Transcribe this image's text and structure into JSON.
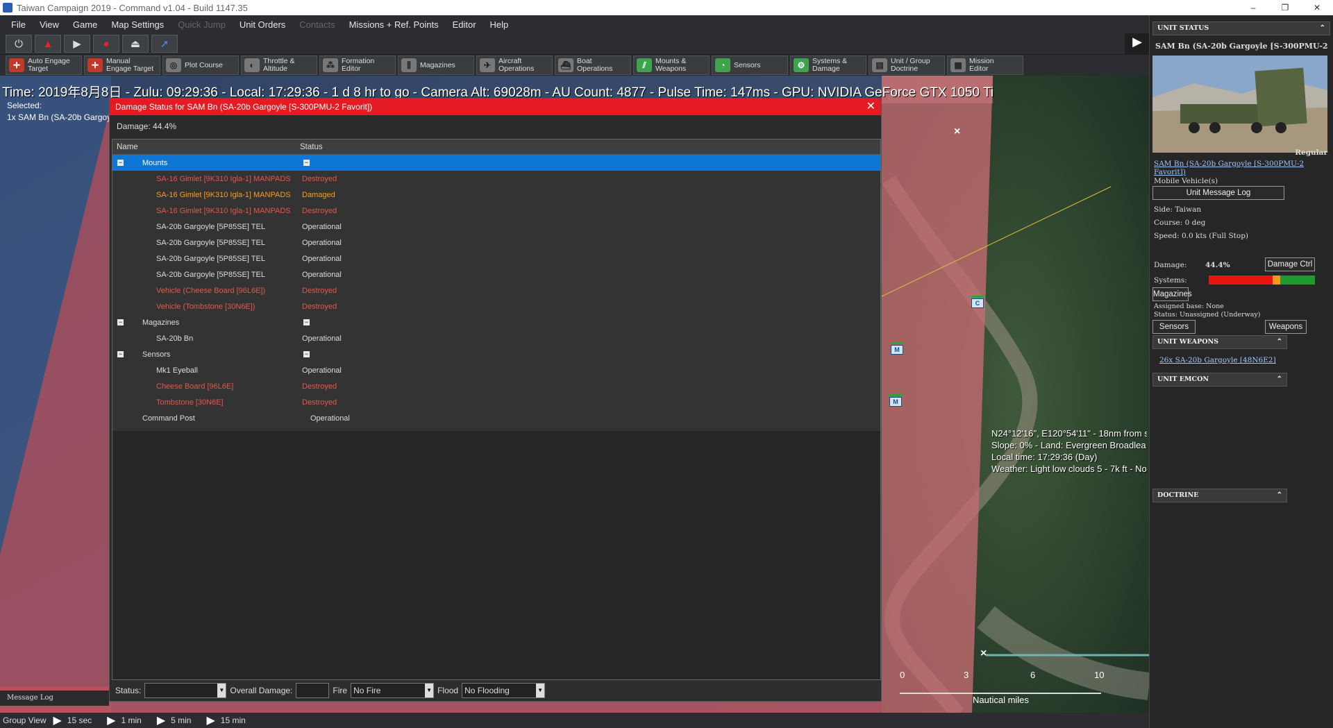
{
  "window": {
    "title": "Taiwan  Campaign 2019 - Command v1.04 - Build 1147.35",
    "buttons": [
      "–",
      "❐",
      "✕"
    ]
  },
  "menubar": {
    "items": [
      {
        "label": "File",
        "enabled": true
      },
      {
        "label": "View",
        "enabled": true
      },
      {
        "label": "Game",
        "enabled": true
      },
      {
        "label": "Map Settings",
        "enabled": true
      },
      {
        "label": "Quick Jump",
        "enabled": false
      },
      {
        "label": "Unit Orders",
        "enabled": true
      },
      {
        "label": "Contacts",
        "enabled": false
      },
      {
        "label": "Missions + Ref. Points",
        "enabled": true
      },
      {
        "label": "Editor",
        "enabled": true
      },
      {
        "label": "Help",
        "enabled": true
      }
    ]
  },
  "toolbar": {
    "row1": [
      {
        "icon": "power-icon",
        "glyph": "⏻"
      },
      {
        "icon": "fire-icon",
        "glyph": "🔥"
      },
      {
        "icon": "play-icon",
        "glyph": "▶"
      },
      {
        "icon": "record-icon",
        "glyph": "●"
      },
      {
        "icon": "eject-icon",
        "glyph": "⏏"
      },
      {
        "icon": "cursor-icon",
        "glyph": "➚"
      }
    ],
    "row2": [
      {
        "line1": "Auto Engage",
        "line2": "Target",
        "icon": "crosshair-icon",
        "style": "red"
      },
      {
        "line1": "Manual",
        "line2": "Engage Target",
        "icon": "crosshair-icon",
        "style": "red"
      },
      {
        "line1": "Plot Course",
        "line2": "",
        "icon": "compass-icon",
        "style": ""
      },
      {
        "line1": "Throttle &",
        "line2": "Altitude",
        "icon": "gauge-icon",
        "style": ""
      },
      {
        "line1": "Formation",
        "line2": "Editor",
        "icon": "formation-icon",
        "style": ""
      },
      {
        "line1": "Magazines",
        "line2": "",
        "icon": "ammo-icon",
        "style": ""
      },
      {
        "line1": "Aircraft",
        "line2": "Operations",
        "icon": "aircraft-icon",
        "style": ""
      },
      {
        "line1": "Boat",
        "line2": "Operations",
        "icon": "boat-icon",
        "style": ""
      },
      {
        "line1": "Mounts &",
        "line2": "Weapons",
        "icon": "weapons-icon",
        "style": "grn"
      },
      {
        "line1": "Sensors",
        "line2": "",
        "icon": "radar-icon",
        "style": "grn"
      },
      {
        "line1": "Systems &",
        "line2": "Damage",
        "icon": "gear-icon",
        "style": "grn"
      },
      {
        "line1": "Unit / Group",
        "line2": "Doctrine",
        "icon": "doctrine-icon",
        "style": ""
      },
      {
        "line1": "Mission",
        "line2": "Editor",
        "icon": "mission-icon",
        "style": ""
      }
    ]
  },
  "hud": {
    "text": "Time: 2019年8月8日 - Zulu: 09:29:36 - Local: 17:29:36 - 1 d 8 hr to go -  Camera Alt: 69028m  - AU Count: 4877 - Pulse Time: 147ms - GPU: NVIDIA GeForce GTX 1050 Ti"
  },
  "selected": {
    "label": "Selected:",
    "unit": "1x SAM Bn (SA-20b Gargoy"
  },
  "map_info": {
    "lines": [
      "N24°12'16\", E120°54'11\" - 18nm from s",
      "Slope: 0%  - Land: Evergreen Broadlea",
      "Local time: 17:29:36 (Day)",
      "Weather: Light low clouds 5 - 7k ft - No"
    ],
    "markers": [
      "C",
      "M",
      "M"
    ]
  },
  "scalebar": {
    "ticks": [
      "0",
      "3",
      "6",
      "10"
    ],
    "units": "Nautical miles"
  },
  "dialog": {
    "title": "Damage Status for SAM Bn (SA-20b Gargoyle [S-300PMU-2 Favorit])",
    "damage": "Damage: 44.4%",
    "columns": {
      "name": "Name",
      "status": "Status"
    },
    "rows": [
      {
        "name": "Mounts",
        "status": "",
        "kind": "group",
        "state": "sel"
      },
      {
        "name": "SA-16 Gimlet [9K310 Igla-1] MANPADS",
        "status": "Destroyed",
        "kind": "item",
        "state": "destroyed"
      },
      {
        "name": "SA-16 Gimlet [9K310 Igla-1] MANPADS",
        "status": "Damaged",
        "kind": "item",
        "state": "damaged"
      },
      {
        "name": "SA-16 Gimlet [9K310 Igla-1] MANPADS",
        "status": "Destroyed",
        "kind": "item",
        "state": "destroyed"
      },
      {
        "name": "SA-20b Gargoyle [5P85SE] TEL",
        "status": "Operational",
        "kind": "item",
        "state": "ok"
      },
      {
        "name": "SA-20b Gargoyle [5P85SE] TEL",
        "status": "Operational",
        "kind": "item",
        "state": "ok"
      },
      {
        "name": "SA-20b Gargoyle [5P85SE] TEL",
        "status": "Operational",
        "kind": "item",
        "state": "ok"
      },
      {
        "name": "SA-20b Gargoyle [5P85SE] TEL",
        "status": "Operational",
        "kind": "item",
        "state": "ok"
      },
      {
        "name": "Vehicle (Cheese Board [96L6E])",
        "status": "Destroyed",
        "kind": "item",
        "state": "destroyed"
      },
      {
        "name": "Vehicle (Tombstone [30N6E])",
        "status": "Destroyed",
        "kind": "item",
        "state": "destroyed"
      },
      {
        "name": "Magazines",
        "status": "",
        "kind": "group",
        "state": "ok"
      },
      {
        "name": "SA-20b Bn",
        "status": "Operational",
        "kind": "item",
        "state": "ok"
      },
      {
        "name": "Sensors",
        "status": "",
        "kind": "group",
        "state": "ok"
      },
      {
        "name": "Mk1 Eyeball",
        "status": "Operational",
        "kind": "item",
        "state": "ok"
      },
      {
        "name": "Cheese Board [96L6E]",
        "status": "Destroyed",
        "kind": "item",
        "state": "destroyed"
      },
      {
        "name": "Tombstone [30N6E]",
        "status": "Destroyed",
        "kind": "item",
        "state": "destroyed"
      },
      {
        "name": "Command Post",
        "status": "Operational",
        "kind": "cmd",
        "state": "ok"
      }
    ],
    "footer": {
      "status_label": "Status:",
      "status_value": "",
      "overall_label": "Overall Damage:",
      "overall_value": "",
      "fire_label": "Fire",
      "fire_value": "No Fire",
      "flood_label": "Flood",
      "flood_value": "No Flooding"
    }
  },
  "right_panel": {
    "unit_status_header": "UNIT STATUS",
    "unit_name": "SAM Bn (SA-20b Gargoyle [S-300PMU-2",
    "proficiency": "Regular",
    "unit_link": "SAM Bn (SA-20b Gargoyle [S-300PMU-2 Favorit])",
    "unit_type": "Mobile Vehicle(s)",
    "message_log_button": "Unit Message Log",
    "side": "Side: Taiwan",
    "course": "Course:  0 deg",
    "speed": "Speed:  0.0 kts (Full Stop)",
    "damage_label": "Damage:",
    "damage_value": "44.4%",
    "damage_ctrl_button": "Damage Ctrl",
    "systems_label": "Systems:",
    "systems_bar": {
      "red": 0.6,
      "orange": 0.07,
      "green": 0.33
    },
    "magazines_button": "Magazines",
    "assigned_base": "Assigned base: None",
    "status": "Status: Unassigned (Underway)",
    "sensors_button": "Sensors",
    "weapons_button": "Weapons",
    "weapons_header": "UNIT WEAPONS",
    "weapon_link": "26x SA-20b Gargoyle [48N6E2]",
    "emcon_header": "UNIT EMCON",
    "doctrine_header": "DOCTRINE"
  },
  "bottom": {
    "message_log": "Message Log",
    "group_view": "Group View",
    "time_steps": [
      "15 sec",
      "1 min",
      "5 min",
      "15 min"
    ]
  }
}
